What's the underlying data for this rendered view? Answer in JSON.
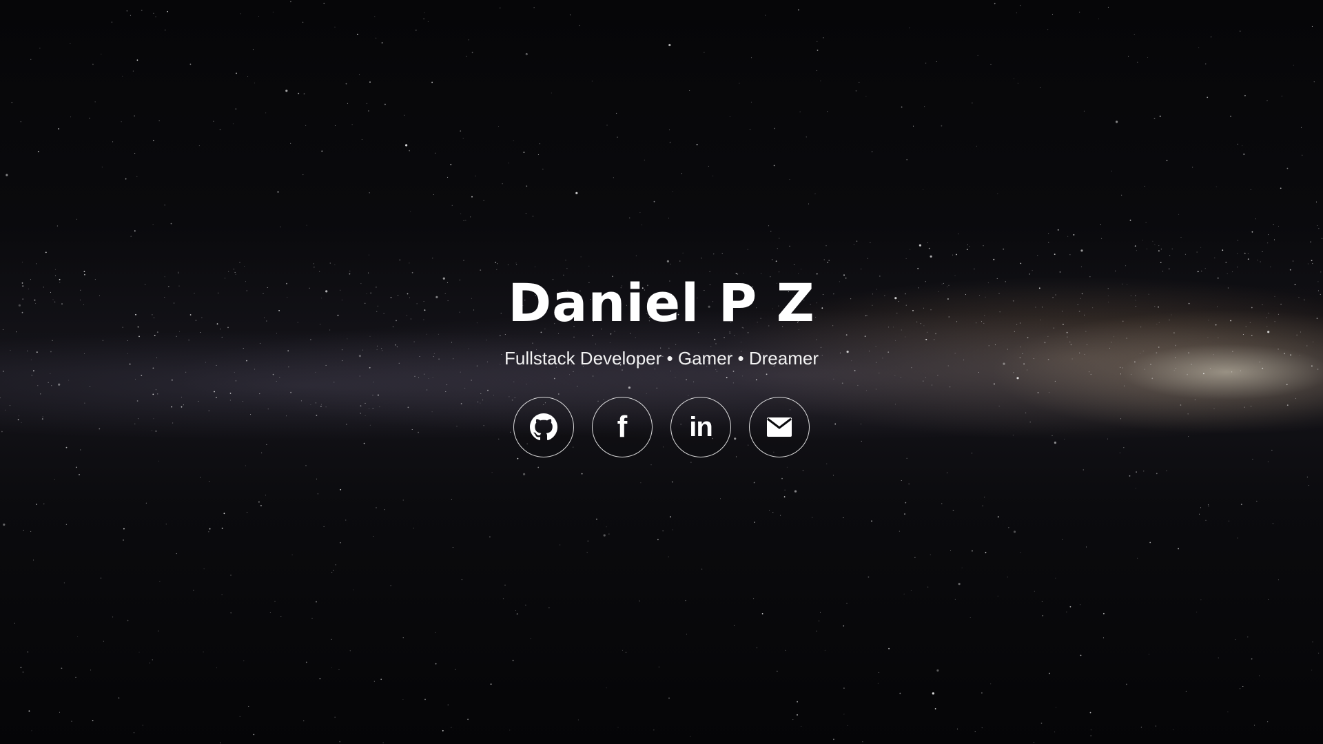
{
  "hero": {
    "name": "Daniel P Z",
    "tagline": "Fullstack Developer • Gamer • Dreamer"
  },
  "socials": [
    {
      "label": "GitHub",
      "icon": "github-icon"
    },
    {
      "label": "Facebook",
      "icon": "facebook-icon",
      "glyph": "f"
    },
    {
      "label": "LinkedIn",
      "icon": "linkedin-icon",
      "glyph": "in"
    },
    {
      "label": "Email",
      "icon": "mail-icon"
    }
  ],
  "colors": {
    "text": "#ffffff",
    "background": "#050507"
  }
}
